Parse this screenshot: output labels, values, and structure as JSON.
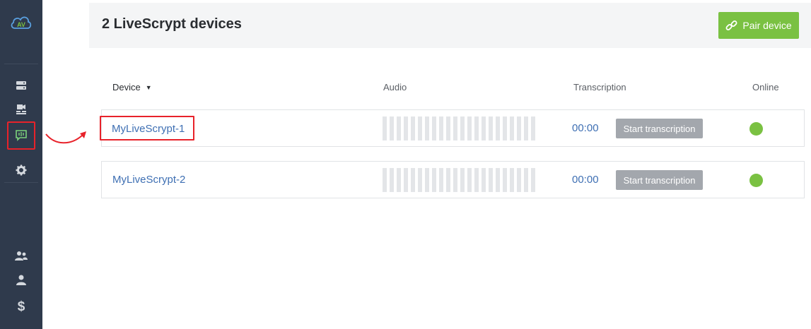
{
  "sidebar": {
    "logo_icon": "av-cloud-logo",
    "items": [
      {
        "icon": "server-icon",
        "active": false
      },
      {
        "icon": "video-recorder-icon",
        "active": false
      },
      {
        "icon": "livescrypt-device-icon",
        "active": true
      },
      {
        "icon": "gear-icon",
        "active": false
      },
      {
        "icon": "users-icon",
        "active": false
      },
      {
        "icon": "user-icon",
        "active": false
      },
      {
        "icon": "dollar-icon",
        "active": false,
        "glyph": "$"
      }
    ]
  },
  "header": {
    "title": "2 LiveScrypt devices",
    "pair_button": "Pair device",
    "pair_icon": "link-icon"
  },
  "table": {
    "columns": {
      "device": "Device",
      "audio": "Audio",
      "transcription": "Transcription",
      "online": "Online"
    },
    "sort_indicator": "▼",
    "rows": [
      {
        "name": "MyLiveScrypt-1",
        "timer": "00:00",
        "action": "Start transcription",
        "online": true,
        "highlighted": true
      },
      {
        "name": "MyLiveScrypt-2",
        "timer": "00:00",
        "action": "Start transcription",
        "online": true,
        "highlighted": false
      }
    ]
  },
  "colors": {
    "sidebar_bg": "#2f3a4c",
    "accent_green": "#7ac142",
    "link_blue": "#3e6fb3",
    "highlight_red": "#e8222a",
    "button_grey": "#a3a7ad"
  }
}
